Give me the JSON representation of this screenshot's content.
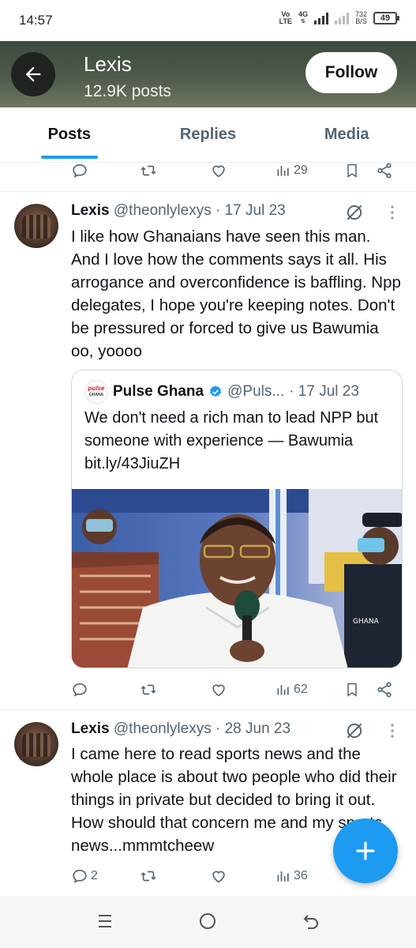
{
  "status_bar": {
    "time": "14:57",
    "volte_top": "Vo",
    "volte_bottom": "LTE",
    "network": "4G",
    "speed_value": "732",
    "speed_unit": "B/S",
    "battery": "49"
  },
  "header": {
    "name": "Lexis",
    "post_count": "12.9K posts",
    "follow_label": "Follow"
  },
  "tabs": [
    {
      "label": "Posts",
      "active": true
    },
    {
      "label": "Replies",
      "active": false
    },
    {
      "label": "Media",
      "active": false
    }
  ],
  "top_actions": {
    "views": "29"
  },
  "tweets": [
    {
      "name": "Lexis",
      "handle": "@theonlylexys",
      "date": "· 17 Jul 23",
      "text": "I like how Ghanaians have seen this man. And I love how the comments says it all. His arrogance and overconfidence is baffling. Npp delegates, I hope you're keeping notes. Don't be pressured or forced to give us Bawumia oo, yoooo",
      "quote": {
        "logo_text_top": "pulse",
        "logo_text_bottom": "GHANA",
        "name": "Pulse Ghana",
        "handle": "@Puls...",
        "date": "· 17 Jul 23",
        "text": "We don't need a rich man to lead NPP but someone with experience — Bawumia bit.ly/43JiuZH",
        "photo_badge": "GHANA"
      },
      "replies": "",
      "views": "62"
    },
    {
      "name": "Lexis",
      "handle": "@theonlylexys",
      "date": "· 28 Jun 23",
      "text": "I came here to read sports news and the whole place is about two people who did their things in private but decided to bring it out. How should that concern me and my sports news...mmmtcheew",
      "replies": "2",
      "views": "36"
    }
  ],
  "colors": {
    "accent": "#1d9bf0",
    "secondary_text": "#536471",
    "primary_text": "#0f1419"
  }
}
